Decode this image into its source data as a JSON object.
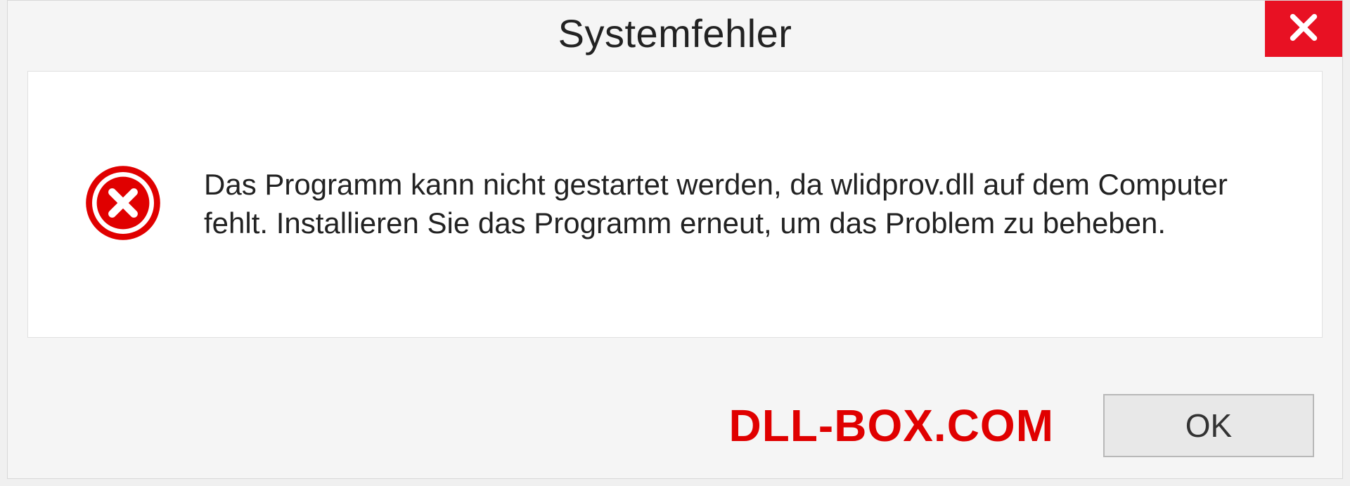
{
  "dialog": {
    "title": "Systemfehler",
    "message": "Das Programm kann nicht gestartet werden, da wlidprov.dll auf dem Computer fehlt. Installieren Sie das Programm erneut, um das Problem zu beheben.",
    "ok_label": "OK"
  },
  "watermark": "DLL-BOX.COM",
  "colors": {
    "close_bg": "#e81123",
    "error_icon": "#e00000",
    "watermark": "#e00000"
  },
  "icons": {
    "close": "close-icon",
    "error": "error-circle-icon"
  }
}
